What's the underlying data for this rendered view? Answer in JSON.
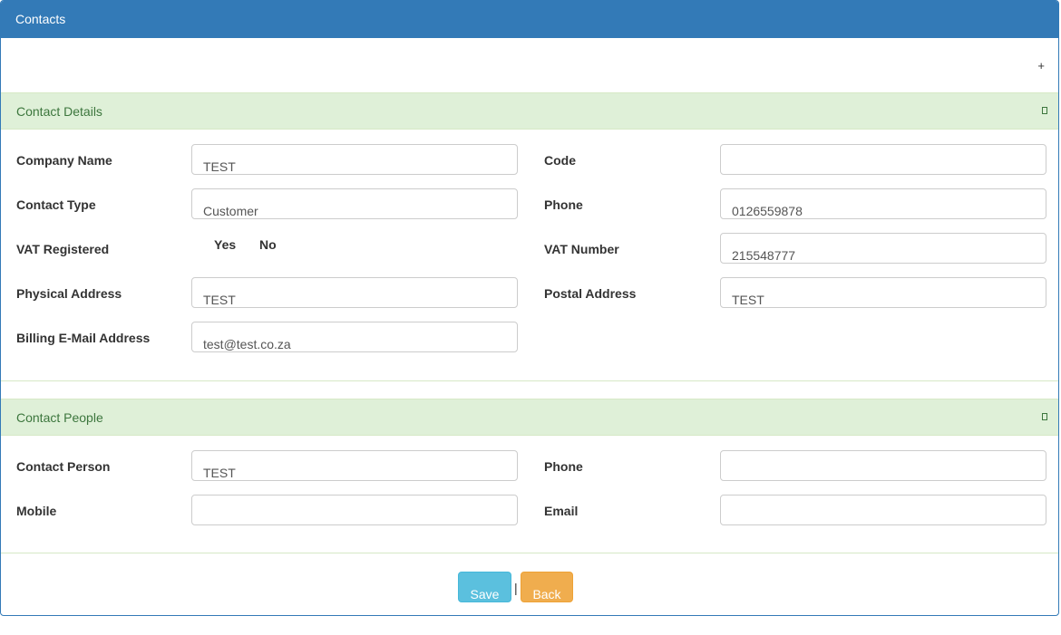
{
  "header": {
    "title": "Contacts",
    "add_symbol": "+"
  },
  "contact_details": {
    "title": "Contact Details",
    "company_name": {
      "label": "Company Name",
      "value": "TEST"
    },
    "code": {
      "label": "Code",
      "value": ""
    },
    "contact_type": {
      "label": "Contact Type",
      "value": "Customer"
    },
    "phone": {
      "label": "Phone",
      "value": "0126559878"
    },
    "vat_registered": {
      "label": "VAT Registered",
      "yes": "Yes",
      "no": "No"
    },
    "vat_number": {
      "label": "VAT Number",
      "value": "215548777"
    },
    "physical_address": {
      "label": "Physical Address",
      "value": "TEST"
    },
    "postal_address": {
      "label": "Postal Address",
      "value": "TEST"
    },
    "billing_email": {
      "label": "Billing E-Mail Address",
      "value": "test@test.co.za"
    }
  },
  "contact_people": {
    "title": "Contact People",
    "contact_person": {
      "label": "Contact Person",
      "value": "TEST"
    },
    "phone": {
      "label": "Phone",
      "value": ""
    },
    "mobile": {
      "label": "Mobile",
      "value": ""
    },
    "email": {
      "label": "Email",
      "value": ""
    }
  },
  "footer": {
    "save_label": "Save",
    "separator": "|",
    "back_label": "Back"
  },
  "colors": {
    "primary": "#337ab7",
    "success_bg": "#dff0d8",
    "success_text": "#3c763d",
    "info": "#5bc0de",
    "warning": "#f0ad4e"
  }
}
